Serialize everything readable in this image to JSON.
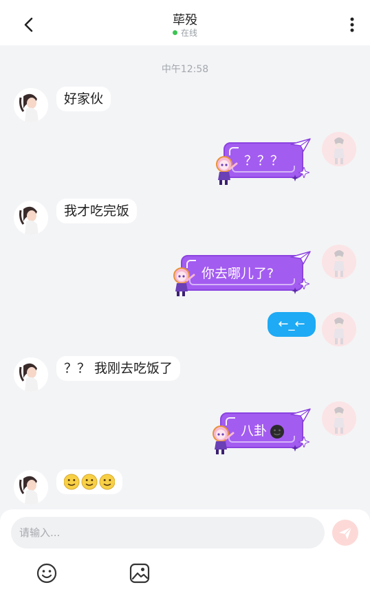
{
  "header": {
    "title": "荜殁",
    "status": "在线",
    "back_icon": "chevron-left-icon",
    "menu_icon": "more-vertical-icon",
    "status_color": "#3cc453"
  },
  "timestamp": "中午12:58",
  "messages": [
    {
      "side": "left",
      "style": "plain",
      "text": "好家伙"
    },
    {
      "side": "right",
      "style": "purple",
      "text": "？？？"
    },
    {
      "side": "left",
      "style": "plain",
      "text": "我才吃完饭"
    },
    {
      "side": "right",
      "style": "purple",
      "text": "你去哪儿了?"
    },
    {
      "side": "right",
      "style": "blue",
      "text": "←_←"
    },
    {
      "side": "left",
      "style": "plain",
      "text": "？？ 我刚去吃饭了"
    },
    {
      "side": "right",
      "style": "purple",
      "text": "八卦"
    },
    {
      "side": "left",
      "style": "emoji",
      "text": "🙂🙂🙂"
    }
  ],
  "composer": {
    "placeholder": "请输入...",
    "send_icon": "send-icon",
    "emoji_icon": "smile-icon",
    "image_icon": "image-icon"
  },
  "colors": {
    "purple_bubble": "#a35cf0",
    "blue_bubble": "#1eaaf4",
    "background": "#f3f4f6"
  }
}
